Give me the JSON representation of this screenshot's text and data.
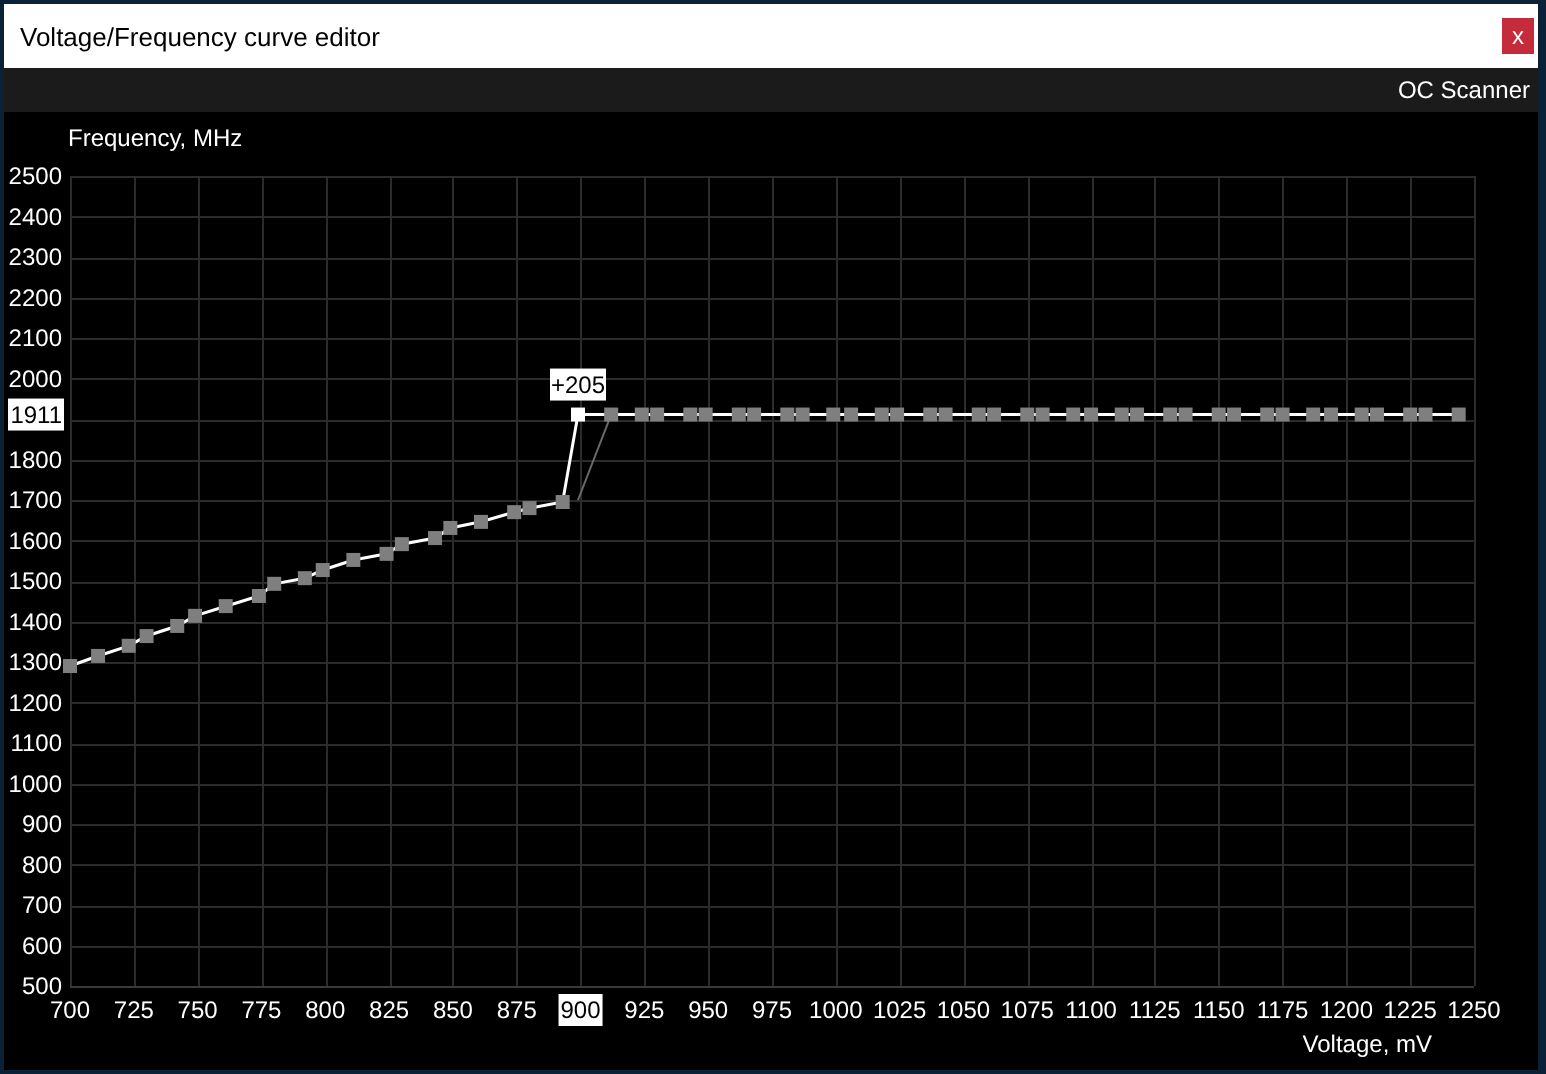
{
  "window": {
    "title": "Voltage/Frequency curve editor",
    "close_label": "x"
  },
  "toolbar": {
    "items": [
      "OC Scanner"
    ]
  },
  "chart": {
    "chart_data": {
      "type": "line",
      "ylabel": "Frequency, MHz",
      "xlabel": "Voltage, mV",
      "grid": true,
      "x": [
        700,
        711,
        723,
        730,
        742,
        749,
        761,
        774,
        780,
        792,
        799,
        811,
        824,
        830,
        843,
        849,
        861,
        874,
        880,
        893,
        899,
        912,
        924,
        930,
        943,
        949,
        962,
        968,
        981,
        987,
        999,
        1006,
        1018,
        1024,
        1037,
        1043,
        1056,
        1062,
        1075,
        1081,
        1093,
        1100,
        1112,
        1118,
        1131,
        1137,
        1150,
        1156,
        1169,
        1175,
        1187,
        1194,
        1206,
        1212,
        1225,
        1231,
        1244
      ],
      "series": [
        {
          "color": "#ffffff",
          "marker": "square",
          "values": [
            1290,
            1315,
            1340,
            1364,
            1389,
            1414,
            1438,
            1463,
            1493,
            1507,
            1527,
            1552,
            1567,
            1591,
            1606,
            1631,
            1646,
            1670,
            1680,
            1695,
            1911,
            1911,
            1911,
            1911,
            1911,
            1911,
            1911,
            1911,
            1911,
            1911,
            1911,
            1911,
            1911,
            1911,
            1911,
            1911,
            1911,
            1911,
            1911,
            1911,
            1911,
            1911,
            1911,
            1911,
            1911,
            1911,
            1911,
            1911,
            1911,
            1911,
            1911,
            1911,
            1911,
            1911,
            1911,
            1911,
            1911
          ]
        },
        {
          "color": "#6a6a6a",
          "values": [
            null,
            null,
            null,
            null,
            null,
            null,
            null,
            null,
            null,
            null,
            null,
            null,
            null,
            null,
            null,
            null,
            null,
            null,
            null,
            null,
            1700,
            1911,
            null,
            null,
            null,
            null,
            null,
            null,
            null,
            null,
            null,
            null,
            null,
            null,
            null,
            null,
            null,
            null,
            null,
            null,
            null,
            null,
            null,
            null,
            null,
            null,
            null,
            null,
            null,
            null,
            null,
            null,
            null,
            null,
            null,
            null,
            null
          ]
        }
      ],
      "xlim": [
        700,
        1250
      ],
      "ylim": [
        500,
        2500
      ],
      "xticks": [
        700,
        725,
        750,
        775,
        800,
        825,
        850,
        875,
        900,
        925,
        950,
        975,
        1000,
        1025,
        1050,
        1075,
        1100,
        1125,
        1150,
        1175,
        1200,
        1225,
        1250
      ],
      "yticks": [
        500,
        600,
        700,
        800,
        900,
        1000,
        1100,
        1200,
        1300,
        1400,
        1500,
        1600,
        1700,
        1800,
        {
          "value": 1911,
          "label": "1911"
        },
        2000,
        2100,
        2200,
        2300,
        2400,
        2500
      ],
      "annotations": [
        {
          "x": 899,
          "y": 1911,
          "text": "+205"
        }
      ]
    }
  }
}
